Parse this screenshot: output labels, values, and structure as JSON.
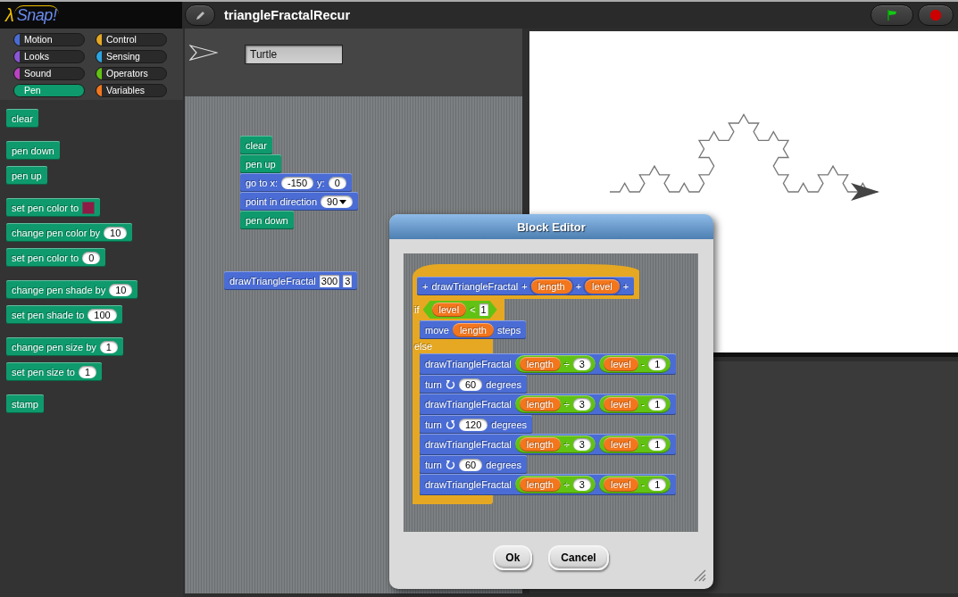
{
  "logo": {
    "symbol": "λ",
    "name": "Snap!"
  },
  "project_title": "triangleFractalRecur",
  "categories": [
    {
      "label": "Motion",
      "color": "#4a6cd4",
      "selected": false
    },
    {
      "label": "Control",
      "color": "#e6a822",
      "selected": false
    },
    {
      "label": "Looks",
      "color": "#8a55d7",
      "selected": false
    },
    {
      "label": "Sensing",
      "color": "#2ca5e2",
      "selected": false
    },
    {
      "label": "Sound",
      "color": "#bb42c3",
      "selected": false
    },
    {
      "label": "Operators",
      "color": "#62c213",
      "selected": false
    },
    {
      "label": "Pen",
      "color": "#0e9a6c",
      "selected": true
    },
    {
      "label": "Variables",
      "color": "#f3761d",
      "selected": false
    }
  ],
  "palette": [
    {
      "blocks": [
        {
          "color": "#0e9a6c",
          "parts": [
            "clear"
          ]
        }
      ]
    },
    {
      "blocks": [
        {
          "color": "#0e9a6c",
          "parts": [
            "pen down"
          ]
        },
        {
          "color": "#0e9a6c",
          "parts": [
            "pen up"
          ]
        }
      ]
    },
    {
      "blocks": [
        {
          "color": "#0e9a6c",
          "parts": [
            "set pen color to",
            {
              "kind": "swatch",
              "color": "#8e1a46"
            }
          ]
        },
        {
          "color": "#0e9a6c",
          "parts": [
            "change pen color by",
            {
              "kind": "num",
              "value": "10"
            }
          ]
        },
        {
          "color": "#0e9a6c",
          "parts": [
            "set pen color to",
            {
              "kind": "num",
              "value": "0"
            }
          ]
        }
      ]
    },
    {
      "blocks": [
        {
          "color": "#0e9a6c",
          "parts": [
            "change pen shade by",
            {
              "kind": "num",
              "value": "10"
            }
          ]
        },
        {
          "color": "#0e9a6c",
          "parts": [
            "set pen shade to",
            {
              "kind": "num",
              "value": "100"
            }
          ]
        }
      ]
    },
    {
      "blocks": [
        {
          "color": "#0e9a6c",
          "parts": [
            "change pen size by",
            {
              "kind": "num",
              "value": "1"
            }
          ]
        },
        {
          "color": "#0e9a6c",
          "parts": [
            "set pen size to",
            {
              "kind": "num",
              "value": "1"
            }
          ]
        }
      ]
    },
    {
      "blocks": [
        {
          "color": "#0e9a6c",
          "parts": [
            "stamp"
          ]
        }
      ]
    }
  ],
  "sprite": {
    "name": "Turtle"
  },
  "scripts": [
    {
      "blocks": [
        {
          "color": "#0e9a6c",
          "parts": [
            "clear"
          ]
        },
        {
          "color": "#0e9a6c",
          "parts": [
            "pen up"
          ]
        },
        {
          "color": "#4a6cd4",
          "parts": [
            "go to x:",
            {
              "kind": "num",
              "value": "-150"
            },
            "y:",
            {
              "kind": "num",
              "value": "0"
            }
          ]
        },
        {
          "color": "#4a6cd4",
          "parts": [
            "point in direction",
            {
              "kind": "dropdown",
              "value": "90"
            }
          ]
        },
        {
          "color": "#0e9a6c",
          "parts": [
            "pen down"
          ]
        }
      ]
    },
    {
      "blocks": [
        {
          "color": "#4a6cd4",
          "parts": [
            "drawTriangleFractal",
            {
              "kind": "slot",
              "value": "300"
            },
            {
              "kind": "slot",
              "value": "3"
            }
          ]
        }
      ]
    }
  ],
  "editor": {
    "title": "Block Editor",
    "prototype": {
      "color": "#4a6cd4",
      "parts": [
        "+",
        "drawTriangleFractal",
        "+",
        {
          "kind": "param",
          "name": "length",
          "color": "#f3761d"
        },
        "+",
        {
          "kind": "param",
          "name": "level",
          "color": "#f3761d"
        },
        "+"
      ]
    },
    "body": {
      "if_label": "if",
      "condition": {
        "kind": "predicate",
        "color": "#62c213",
        "parts": [
          {
            "kind": "var",
            "name": "level",
            "color": "#f3761d"
          },
          "<",
          {
            "kind": "slot",
            "value": "1"
          }
        ]
      },
      "then": [
        {
          "color": "#4a6cd4",
          "parts": [
            "move",
            {
              "kind": "var",
              "name": "length",
              "color": "#f3761d"
            },
            "steps"
          ]
        }
      ],
      "else_label": "else",
      "else": [
        {
          "color": "#4a6cd4",
          "parts": [
            "drawTriangleFractal",
            {
              "kind": "reporter",
              "color": "#62c213",
              "parts": [
                {
                  "kind": "var",
                  "name": "length",
                  "color": "#f3761d"
                },
                "÷",
                {
                  "kind": "num",
                  "value": "3"
                }
              ]
            },
            {
              "kind": "reporter",
              "color": "#62c213",
              "parts": [
                {
                  "kind": "var",
                  "name": "level",
                  "color": "#f3761d"
                },
                "-",
                {
                  "kind": "num",
                  "value": "1"
                }
              ]
            }
          ]
        },
        {
          "color": "#4a6cd4",
          "parts": [
            "turn",
            {
              "kind": "turn-left"
            },
            {
              "kind": "num",
              "value": "60"
            },
            "degrees"
          ]
        },
        {
          "color": "#4a6cd4",
          "parts": [
            "drawTriangleFractal",
            {
              "kind": "reporter",
              "color": "#62c213",
              "parts": [
                {
                  "kind": "var",
                  "name": "length",
                  "color": "#f3761d"
                },
                "÷",
                {
                  "kind": "num",
                  "value": "3"
                }
              ]
            },
            {
              "kind": "reporter",
              "color": "#62c213",
              "parts": [
                {
                  "kind": "var",
                  "name": "level",
                  "color": "#f3761d"
                },
                "-",
                {
                  "kind": "num",
                  "value": "1"
                }
              ]
            }
          ]
        },
        {
          "color": "#4a6cd4",
          "parts": [
            "turn",
            {
              "kind": "turn-right"
            },
            {
              "kind": "num",
              "value": "120"
            },
            "degrees"
          ]
        },
        {
          "color": "#4a6cd4",
          "parts": [
            "drawTriangleFractal",
            {
              "kind": "reporter",
              "color": "#62c213",
              "parts": [
                {
                  "kind": "var",
                  "name": "length",
                  "color": "#f3761d"
                },
                "÷",
                {
                  "kind": "num",
                  "value": "3"
                }
              ]
            },
            {
              "kind": "reporter",
              "color": "#62c213",
              "parts": [
                {
                  "kind": "var",
                  "name": "level",
                  "color": "#f3761d"
                },
                "-",
                {
                  "kind": "num",
                  "value": "1"
                }
              ]
            }
          ]
        },
        {
          "color": "#4a6cd4",
          "parts": [
            "turn",
            {
              "kind": "turn-left"
            },
            {
              "kind": "num",
              "value": "60"
            },
            "degrees"
          ]
        },
        {
          "color": "#4a6cd4",
          "parts": [
            "drawTriangleFractal",
            {
              "kind": "reporter",
              "color": "#62c213",
              "parts": [
                {
                  "kind": "var",
                  "name": "length",
                  "color": "#f3761d"
                },
                "÷",
                {
                  "kind": "num",
                  "value": "3"
                }
              ]
            },
            {
              "kind": "reporter",
              "color": "#62c213",
              "parts": [
                {
                  "kind": "var",
                  "name": "level",
                  "color": "#f3761d"
                },
                "-",
                {
                  "kind": "num",
                  "value": "1"
                }
              ]
            }
          ]
        }
      ]
    },
    "buttons": [
      {
        "label": "Ok"
      },
      {
        "label": "Cancel"
      }
    ]
  }
}
